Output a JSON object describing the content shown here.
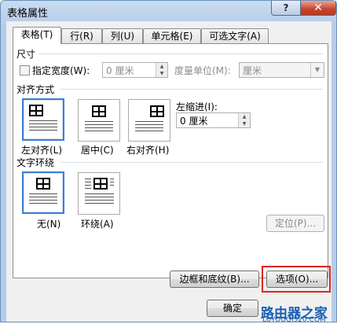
{
  "window": {
    "title": "表格属性",
    "help_label": "?",
    "close_label": "✕"
  },
  "tabs": [
    {
      "label": "表格(T)"
    },
    {
      "label": "行(R)"
    },
    {
      "label": "列(U)"
    },
    {
      "label": "单元格(E)"
    },
    {
      "label": "可选文字(A)"
    }
  ],
  "size": {
    "heading": "尺寸",
    "preferred_width_label": "指定宽度(W):",
    "preferred_width_value": "0 厘米",
    "measure_label": "度量单位(M):",
    "measure_value": "厘米"
  },
  "alignment": {
    "heading": "对齐方式",
    "options": [
      "左对齐(L)",
      "居中(C)",
      "右对齐(H)"
    ],
    "indent_label": "左缩进(I):",
    "indent_value": "0 厘米"
  },
  "wrapping": {
    "heading": "文字环绕",
    "options": [
      "无(N)",
      "环绕(A)"
    ],
    "position_button": "定位(P)..."
  },
  "buttons": {
    "borders": "边框和底纹(B)...",
    "options": "选项(O)...",
    "ok": "确定"
  },
  "watermark": {
    "brand": "路由器之家",
    "url": "LUYOUQI520.COM"
  },
  "colors": {
    "selected_border": "#3c7fd1",
    "highlight": "#d9261c",
    "close_button": "#c5432b"
  }
}
